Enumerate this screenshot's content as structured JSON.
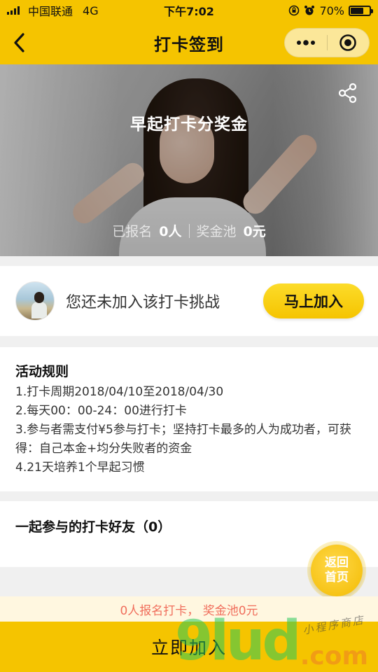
{
  "status_bar": {
    "carrier": "中国联通",
    "network": "4G",
    "time": "下午7:02",
    "battery": "70%",
    "battery_level": 0.7
  },
  "nav": {
    "title": "打卡签到",
    "back_icon": "chevron-left-icon",
    "more_icon": "more-dots-icon",
    "close_icon": "target-circle-icon"
  },
  "banner": {
    "title": "早起打卡分奖金",
    "registered_label": "已报名",
    "registered_value": "0人",
    "pool_label": "奖金池",
    "pool_value": "0元",
    "share_icon": "share-icon"
  },
  "join": {
    "status_text": "您还未加入该打卡挑战",
    "button_label": "马上加入"
  },
  "rules": {
    "title": "活动规则",
    "lines": [
      "1.打卡周期2018/04/10至2018/04/30",
      "2.每天00：00-24：00进行打卡",
      "3.参与者需支付¥5参与打卡；坚持打卡最多的人为成功者，可获",
      "得：自己本金+均分失败者的资金",
      "4.21天培养1个早起习惯"
    ]
  },
  "friends": {
    "title": "一起参与的打卡好友（0）"
  },
  "home_button": {
    "line1": "返回",
    "line2": "首页"
  },
  "summary": {
    "text": "0人报名打卡， 奖金池0元"
  },
  "bottom_button": {
    "label": "立即加入"
  },
  "watermark": {
    "big": "9lud",
    "com": ".com",
    "small": "小程序商店"
  },
  "colors": {
    "brand_yellow": "#f5c400",
    "summary_text": "#f06e5c",
    "summary_bg": "#fff7e0"
  }
}
